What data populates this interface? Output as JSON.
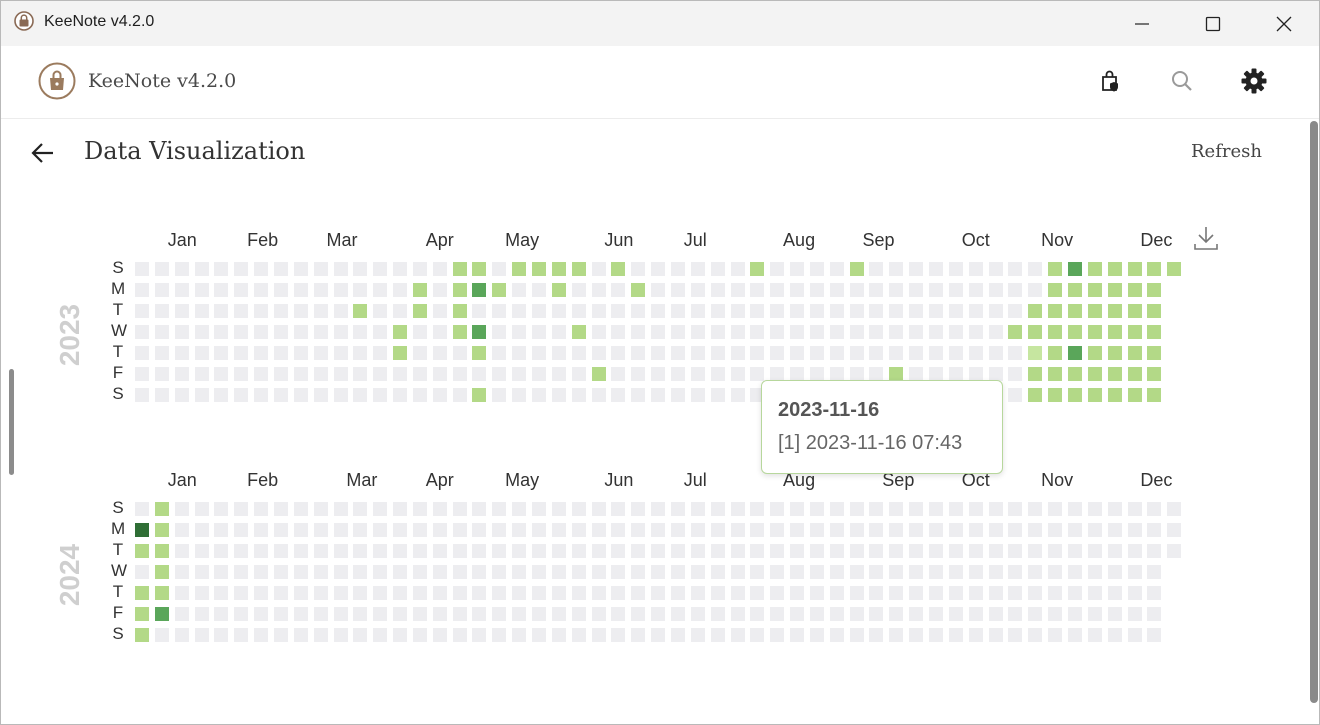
{
  "window": {
    "title": "KeeNote v4.2.0"
  },
  "appbar": {
    "name": "KeeNote v4.2.0",
    "icons": [
      "lock-bag-icon",
      "search-icon",
      "gear-icon"
    ]
  },
  "page": {
    "title": "Data Visualization",
    "refresh_label": "Refresh"
  },
  "colors": {
    "empty": "#ededf0",
    "level1": "#b3d987",
    "level1_light": "#c6e6a0",
    "level2": "#5aa65a",
    "level3": "#2f6e35",
    "tooltip_border": "#b7d79c"
  },
  "day_labels": [
    "S",
    "M",
    "T",
    "W",
    "T",
    "F",
    "S"
  ],
  "heatmaps": [
    {
      "year": "2023",
      "months": [
        "Jan",
        "Feb",
        "Mar",
        "Apr",
        "May",
        "Jun",
        "Jul",
        "Aug",
        "Sep",
        "Oct",
        "Nov",
        "Dec"
      ],
      "month_weeks": [
        2,
        6,
        10,
        15,
        19,
        24,
        28,
        33,
        37,
        42,
        46,
        51
      ],
      "weeks": 53,
      "active": [
        [
          16,
          0,
          1
        ],
        [
          17,
          0,
          1
        ],
        [
          19,
          0,
          1
        ],
        [
          20,
          0,
          1
        ],
        [
          21,
          0,
          1
        ],
        [
          22,
          0,
          1
        ],
        [
          24,
          0,
          1
        ],
        [
          31,
          0,
          1
        ],
        [
          36,
          0,
          1
        ],
        [
          46,
          0,
          1
        ],
        [
          47,
          0,
          2
        ],
        [
          48,
          0,
          1
        ],
        [
          49,
          0,
          1
        ],
        [
          50,
          0,
          1
        ],
        [
          51,
          0,
          1
        ],
        [
          52,
          0,
          1
        ],
        [
          14,
          1,
          1
        ],
        [
          16,
          1,
          1
        ],
        [
          17,
          1,
          2
        ],
        [
          18,
          1,
          1
        ],
        [
          21,
          1,
          1
        ],
        [
          25,
          1,
          1
        ],
        [
          46,
          1,
          1
        ],
        [
          47,
          1,
          1
        ],
        [
          48,
          1,
          1
        ],
        [
          49,
          1,
          1
        ],
        [
          50,
          1,
          1
        ],
        [
          51,
          1,
          1
        ],
        [
          11,
          2,
          1
        ],
        [
          14,
          2,
          1
        ],
        [
          16,
          2,
          1
        ],
        [
          45,
          2,
          1
        ],
        [
          46,
          2,
          1
        ],
        [
          47,
          2,
          1
        ],
        [
          48,
          2,
          1
        ],
        [
          49,
          2,
          1
        ],
        [
          50,
          2,
          1
        ],
        [
          51,
          2,
          1
        ],
        [
          13,
          3,
          1
        ],
        [
          16,
          3,
          1
        ],
        [
          17,
          3,
          2
        ],
        [
          22,
          3,
          1
        ],
        [
          44,
          3,
          1
        ],
        [
          45,
          3,
          1
        ],
        [
          46,
          3,
          1
        ],
        [
          47,
          3,
          1
        ],
        [
          48,
          3,
          1
        ],
        [
          49,
          3,
          1
        ],
        [
          50,
          3,
          1
        ],
        [
          51,
          3,
          1
        ],
        [
          13,
          4,
          1
        ],
        [
          17,
          4,
          1
        ],
        [
          45,
          4,
          4
        ],
        [
          46,
          4,
          1
        ],
        [
          47,
          4,
          2
        ],
        [
          48,
          4,
          1
        ],
        [
          49,
          4,
          1
        ],
        [
          50,
          4,
          1
        ],
        [
          51,
          4,
          1
        ],
        [
          23,
          5,
          1
        ],
        [
          38,
          5,
          1
        ],
        [
          45,
          5,
          1
        ],
        [
          46,
          5,
          1
        ],
        [
          47,
          5,
          1
        ],
        [
          48,
          5,
          1
        ],
        [
          49,
          5,
          1
        ],
        [
          50,
          5,
          1
        ],
        [
          51,
          5,
          1
        ],
        [
          17,
          6,
          1
        ],
        [
          45,
          6,
          1
        ],
        [
          46,
          6,
          1
        ],
        [
          47,
          6,
          1
        ],
        [
          48,
          6,
          1
        ],
        [
          49,
          6,
          1
        ],
        [
          50,
          6,
          1
        ],
        [
          51,
          6,
          1
        ]
      ]
    },
    {
      "year": "2024",
      "months": [
        "Jan",
        "Feb",
        "Mar",
        "Apr",
        "May",
        "Jun",
        "Jul",
        "Aug",
        "Sep",
        "Oct",
        "Nov",
        "Dec"
      ],
      "month_weeks": [
        2,
        6,
        11,
        15,
        19,
        24,
        28,
        33,
        38,
        42,
        46,
        51
      ],
      "weeks": 53,
      "active": [
        [
          1,
          0,
          1
        ],
        [
          0,
          1,
          3
        ],
        [
          1,
          1,
          1
        ],
        [
          0,
          2,
          1
        ],
        [
          1,
          2,
          1
        ],
        [
          1,
          3,
          1
        ],
        [
          0,
          4,
          1
        ],
        [
          1,
          4,
          1
        ],
        [
          0,
          5,
          1
        ],
        [
          1,
          5,
          2
        ],
        [
          0,
          6,
          1
        ]
      ]
    }
  ],
  "tooltip": {
    "date": "2023-11-16",
    "entry": "[1] 2023-11-16 07:43"
  }
}
